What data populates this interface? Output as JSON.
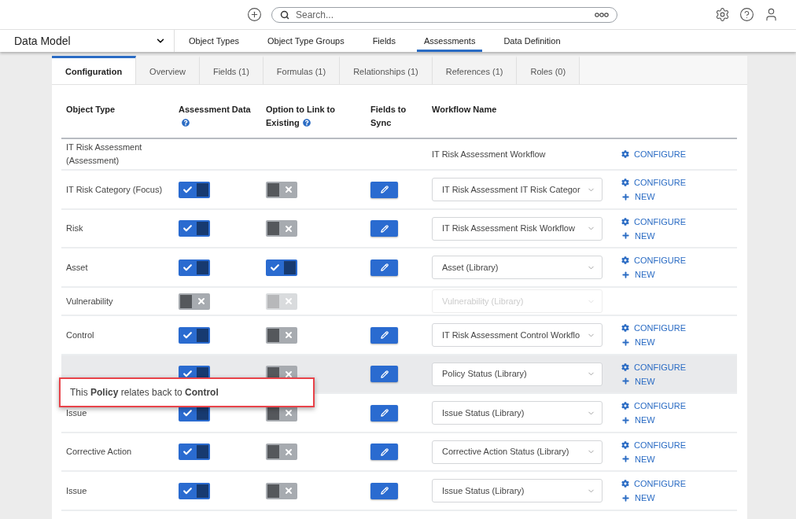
{
  "top_bar": {
    "search": {
      "placeholder": "Search..."
    }
  },
  "nav": {
    "title": "Data Model",
    "items": [
      {
        "label": "Object Types",
        "selected": false
      },
      {
        "label": "Object Type Groups",
        "selected": false
      },
      {
        "label": "Fields",
        "selected": false
      },
      {
        "label": "Assessments",
        "selected": true
      },
      {
        "label": "Data Definition",
        "selected": false
      }
    ]
  },
  "tabs": [
    {
      "label": "Configuration",
      "selected": true
    },
    {
      "label": "Overview",
      "selected": false
    },
    {
      "label": "Fields (1)",
      "selected": false
    },
    {
      "label": "Formulas (1)",
      "selected": false
    },
    {
      "label": "Relationships (1)",
      "selected": false
    },
    {
      "label": "References (1)",
      "selected": false
    },
    {
      "label": "Roles (0)",
      "selected": false
    }
  ],
  "table": {
    "columns": [
      {
        "label": "Object Type",
        "help": false
      },
      {
        "label": "Assessment Data",
        "help": true
      },
      {
        "label": "Option to Link to Existing",
        "help": true
      },
      {
        "label": "Fields to Sync",
        "help": false
      },
      {
        "label": "Workflow Name",
        "help": false
      }
    ],
    "rows": [
      {
        "name": "IT Risk Assessment (Assessment)",
        "workflow": {
          "kind": "text",
          "value": "IT Risk Assessment Workflow"
        },
        "actions": [
          {
            "kind": "configure",
            "label": "CONFIGURE"
          }
        ],
        "hovered": false
      },
      {
        "name": "IT Risk Category (Focus)",
        "assessment_data": {
          "on": true,
          "disabled": false
        },
        "link_existing": {
          "on": false,
          "disabled": false
        },
        "sync": true,
        "workflow": {
          "kind": "select",
          "value": "IT Risk Assessment IT Risk Categor",
          "disabled": false
        },
        "actions": [
          {
            "kind": "configure",
            "label": "CONFIGURE"
          },
          {
            "kind": "new",
            "label": "NEW"
          }
        ],
        "hovered": false
      },
      {
        "name": "Risk",
        "assessment_data": {
          "on": true,
          "disabled": false
        },
        "link_existing": {
          "on": false,
          "disabled": false
        },
        "sync": true,
        "workflow": {
          "kind": "select",
          "value": "IT Risk Assessment Risk Workflow",
          "disabled": false
        },
        "actions": [
          {
            "kind": "configure",
            "label": "CONFIGURE"
          },
          {
            "kind": "new",
            "label": "NEW"
          }
        ],
        "hovered": false
      },
      {
        "name": "Asset",
        "assessment_data": {
          "on": true,
          "disabled": false
        },
        "link_existing": {
          "on": true,
          "disabled": false
        },
        "sync": true,
        "workflow": {
          "kind": "select",
          "value": "Asset (Library)",
          "disabled": false
        },
        "actions": [
          {
            "kind": "configure",
            "label": "CONFIGURE"
          },
          {
            "kind": "new",
            "label": "NEW"
          }
        ],
        "hovered": false
      },
      {
        "name": "Vulnerability",
        "assessment_data": {
          "on": false,
          "disabled": false
        },
        "link_existing": {
          "on": false,
          "disabled": true
        },
        "sync": false,
        "workflow": {
          "kind": "select",
          "value": "Vulnerability (Library)",
          "disabled": true
        },
        "hovered": false
      },
      {
        "name": "Control",
        "assessment_data": {
          "on": true,
          "disabled": false
        },
        "link_existing": {
          "on": false,
          "disabled": false
        },
        "sync": true,
        "workflow": {
          "kind": "select",
          "value": "IT Risk Assessment Control Workflo",
          "disabled": false
        },
        "actions": [
          {
            "kind": "configure",
            "label": "CONFIGURE"
          },
          {
            "kind": "new",
            "label": "NEW"
          }
        ],
        "hovered": false
      },
      {
        "assessment_data": {
          "on": true,
          "disabled": false
        },
        "link_existing": {
          "on": false,
          "disabled": false
        },
        "sync": true,
        "workflow": {
          "kind": "select",
          "value": "Policy Status (Library)",
          "disabled": false
        },
        "actions": [
          {
            "kind": "configure",
            "label": "CONFIGURE"
          },
          {
            "kind": "new",
            "label": "NEW"
          }
        ],
        "hovered": true
      },
      {
        "name": "Issue",
        "assessment_data": {
          "on": true,
          "disabled": false
        },
        "link_existing": {
          "on": false,
          "disabled": false
        },
        "sync": true,
        "workflow": {
          "kind": "select",
          "value": "Issue Status (Library)",
          "disabled": false
        },
        "actions": [
          {
            "kind": "configure",
            "label": "CONFIGURE"
          },
          {
            "kind": "new",
            "label": "NEW"
          }
        ],
        "hovered": false
      },
      {
        "name": "Corrective Action",
        "assessment_data": {
          "on": true,
          "disabled": false
        },
        "link_existing": {
          "on": false,
          "disabled": false
        },
        "sync": true,
        "workflow": {
          "kind": "select",
          "value": "Corrective Action Status (Library)",
          "disabled": false
        },
        "actions": [
          {
            "kind": "configure",
            "label": "CONFIGURE"
          },
          {
            "kind": "new",
            "label": "NEW"
          }
        ],
        "hovered": false
      },
      {
        "name": "Issue",
        "assessment_data": {
          "on": true,
          "disabled": false
        },
        "link_existing": {
          "on": false,
          "disabled": false
        },
        "sync": true,
        "workflow": {
          "kind": "select",
          "value": "Issue Status (Library)",
          "disabled": false
        },
        "actions": [
          {
            "kind": "configure",
            "label": "CONFIGURE"
          },
          {
            "kind": "new",
            "label": "NEW"
          }
        ],
        "hovered": false
      }
    ]
  },
  "tooltip": {
    "text": "This **Policy** relates back to **Control**"
  }
}
